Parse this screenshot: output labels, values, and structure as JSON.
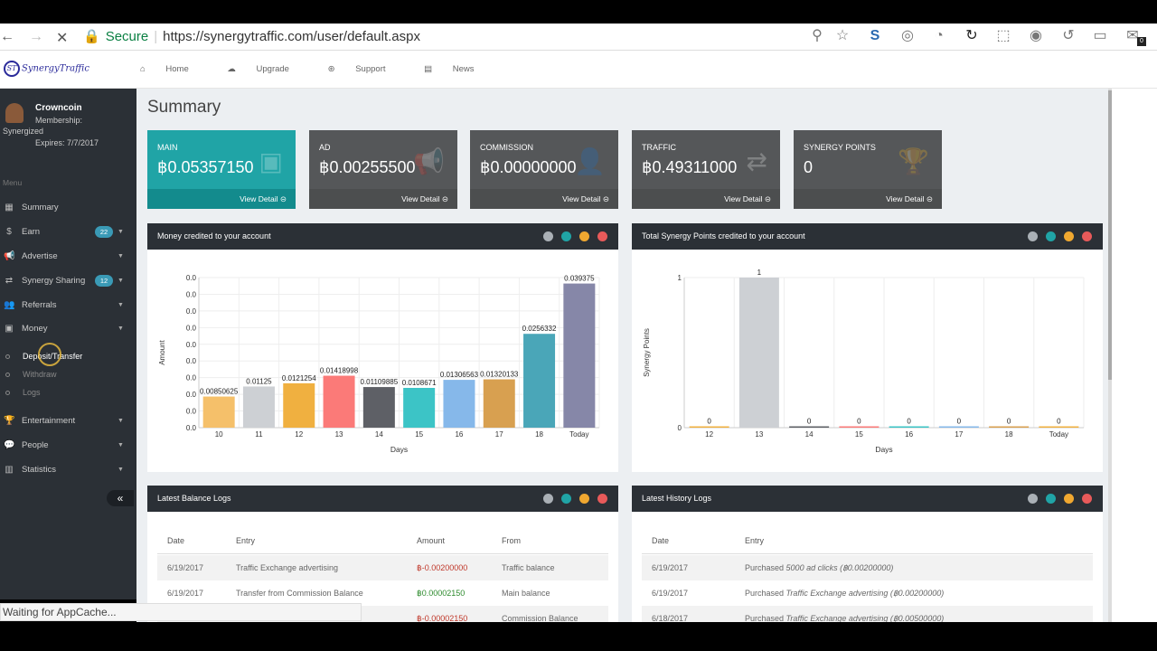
{
  "browser": {
    "secure_label": "Secure",
    "url": "https://synergytraffic.com/user/default.aspx",
    "status": "Waiting for AppCache...",
    "mail_badge": "0"
  },
  "site": {
    "logo_text": "SynergyTraffic",
    "logo_mark": "ST",
    "nav": [
      "Home",
      "Upgrade",
      "Support",
      "News"
    ]
  },
  "profile": {
    "name": "Crowncoin",
    "membership_label": "Membership:",
    "membership": "Synergized",
    "expires": "Expires: 7/7/2017"
  },
  "sidebar": {
    "menu_label": "Menu",
    "items": [
      {
        "label": "Summary",
        "icon": "dashboard-icon"
      },
      {
        "label": "Earn",
        "icon": "dollar-icon",
        "badge": "22"
      },
      {
        "label": "Advertise",
        "icon": "megaphone-icon"
      },
      {
        "label": "Synergy Sharing",
        "icon": "exchange-icon",
        "badge": "12"
      },
      {
        "label": "Referrals",
        "icon": "users-icon"
      },
      {
        "label": "Money",
        "icon": "money-icon"
      },
      {
        "label": "Entertainment",
        "icon": "trophy-icon"
      },
      {
        "label": "People",
        "icon": "comments-icon"
      },
      {
        "label": "Statistics",
        "icon": "bar-chart-icon"
      }
    ],
    "money_sub": [
      "Deposit/Transfer",
      "Withdraw",
      "Logs"
    ],
    "collapse_glyph": "«"
  },
  "page_title": "Summary",
  "cards": [
    {
      "title": "MAIN",
      "value": "฿0.05357150",
      "link": "View Detail"
    },
    {
      "title": "AD",
      "value": "฿0.00255500",
      "link": "View Detail"
    },
    {
      "title": "COMMISSION",
      "value": "฿0.00000000",
      "link": "View Detail"
    },
    {
      "title": "TRAFFIC",
      "value": "฿0.49311000",
      "link": "View Detail"
    },
    {
      "title": "SYNERGY POINTS",
      "value": "0",
      "link": "View Detail"
    }
  ],
  "panels": {
    "money_title": "Money credited to your account",
    "points_title": "Total Synergy Points credited to your account",
    "balance_title": "Latest Balance Logs",
    "history_title": "Latest History Logs"
  },
  "colors": {
    "teal": "#20a4a6",
    "dark": "#2b3036",
    "ctrl_grey": "#aab0b6",
    "ctrl_teal": "#20a4a6",
    "ctrl_orange": "#f0a830",
    "ctrl_red": "#e85a5a"
  },
  "chart_data": [
    {
      "type": "bar",
      "xlabel": "Days",
      "ylabel": "Amount",
      "ytick_labels": [
        "0.0",
        "0.0",
        "0.0",
        "0.0",
        "0.0",
        "0.0",
        "0.0",
        "0.0",
        "0.0",
        "0.0"
      ],
      "ylim": [
        0,
        0.041
      ],
      "categories": [
        "10",
        "11",
        "12",
        "13",
        "14",
        "15",
        "16",
        "17",
        "18",
        "Today"
      ],
      "values": [
        0.00850625,
        0.01125,
        0.0121254,
        0.01418998,
        0.01109885,
        0.0108671,
        0.01306563,
        0.01320133,
        0.0256332,
        0.039375
      ],
      "labels": [
        "0.00850625",
        "0.01125",
        "0.0121254",
        "0.01418998",
        "0.01109885",
        "0.0108671",
        "0.01306563",
        "0.01320133",
        "0.0256332",
        "0.039375"
      ],
      "bar_colors": [
        "#f5c06a",
        "#cdd0d4",
        "#f0b040",
        "#fb7a78",
        "#5e6066",
        "#3cc4c6",
        "#86b8ea",
        "#d8a050",
        "#4aa6b8",
        "#8687a8"
      ],
      "grid": true
    },
    {
      "type": "bar",
      "xlabel": "Days",
      "ylabel": "Synergy Points",
      "ytick_labels": [
        "0",
        "1"
      ],
      "ylim": [
        0,
        1
      ],
      "categories": [
        "12",
        "13",
        "14",
        "15",
        "16",
        "17",
        "18",
        "Today"
      ],
      "values": [
        0,
        1,
        0,
        0,
        0,
        0,
        0,
        0
      ],
      "labels": [
        "0",
        "1",
        "0",
        "0",
        "0",
        "0",
        "0",
        "0"
      ],
      "bar_colors": [
        "#f0b040",
        "#cdd0d4",
        "#5e6066",
        "#fb7a78",
        "#3cc4c6",
        "#86b8ea",
        "#d8a050",
        "#f0b040"
      ],
      "grid": true
    }
  ],
  "balance_logs": {
    "headers": [
      "Date",
      "Entry",
      "Amount",
      "From"
    ],
    "rows": [
      {
        "date": "6/19/2017",
        "entry": "Traffic Exchange advertising",
        "amount": "฿-0.00200000",
        "from": "Traffic balance",
        "neg": true
      },
      {
        "date": "6/19/2017",
        "entry": "Transfer from Commission Balance",
        "amount": "฿0.00002150",
        "from": "Main balance",
        "neg": false
      },
      {
        "date": "",
        "entry": "",
        "amount": "฿-0.00002150",
        "from": "Commission Balance",
        "neg": true
      }
    ]
  },
  "history_logs": {
    "headers": [
      "Date",
      "Entry"
    ],
    "rows": [
      {
        "date": "6/19/2017",
        "prefix": "Purchased",
        "item": "5000 ad clicks (฿0.00200000)"
      },
      {
        "date": "6/19/2017",
        "prefix": "Purchased",
        "item": "Traffic Exchange advertising (฿0.00200000)"
      },
      {
        "date": "6/18/2017",
        "prefix": "Purchased",
        "item": "Traffic Exchange advertising (฿0.00500000)"
      }
    ]
  }
}
